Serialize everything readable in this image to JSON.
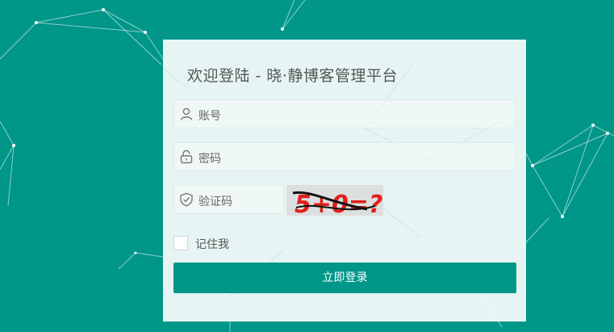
{
  "login": {
    "title": "欢迎登陆 - 晓·静博客管理平台",
    "username_placeholder": "账号",
    "password_placeholder": "密码",
    "captcha_placeholder": "验证码",
    "captcha_text": "5+0=?",
    "remember_label": "记住我",
    "remember_checked": false,
    "submit_label": "立即登录"
  },
  "icons": {
    "username": "user-icon",
    "password": "lock-icon",
    "captcha": "shield-check-icon"
  },
  "colors": {
    "accent": "#009688",
    "panel": "#e8f4f3",
    "captcha_red": "#e0201a"
  }
}
